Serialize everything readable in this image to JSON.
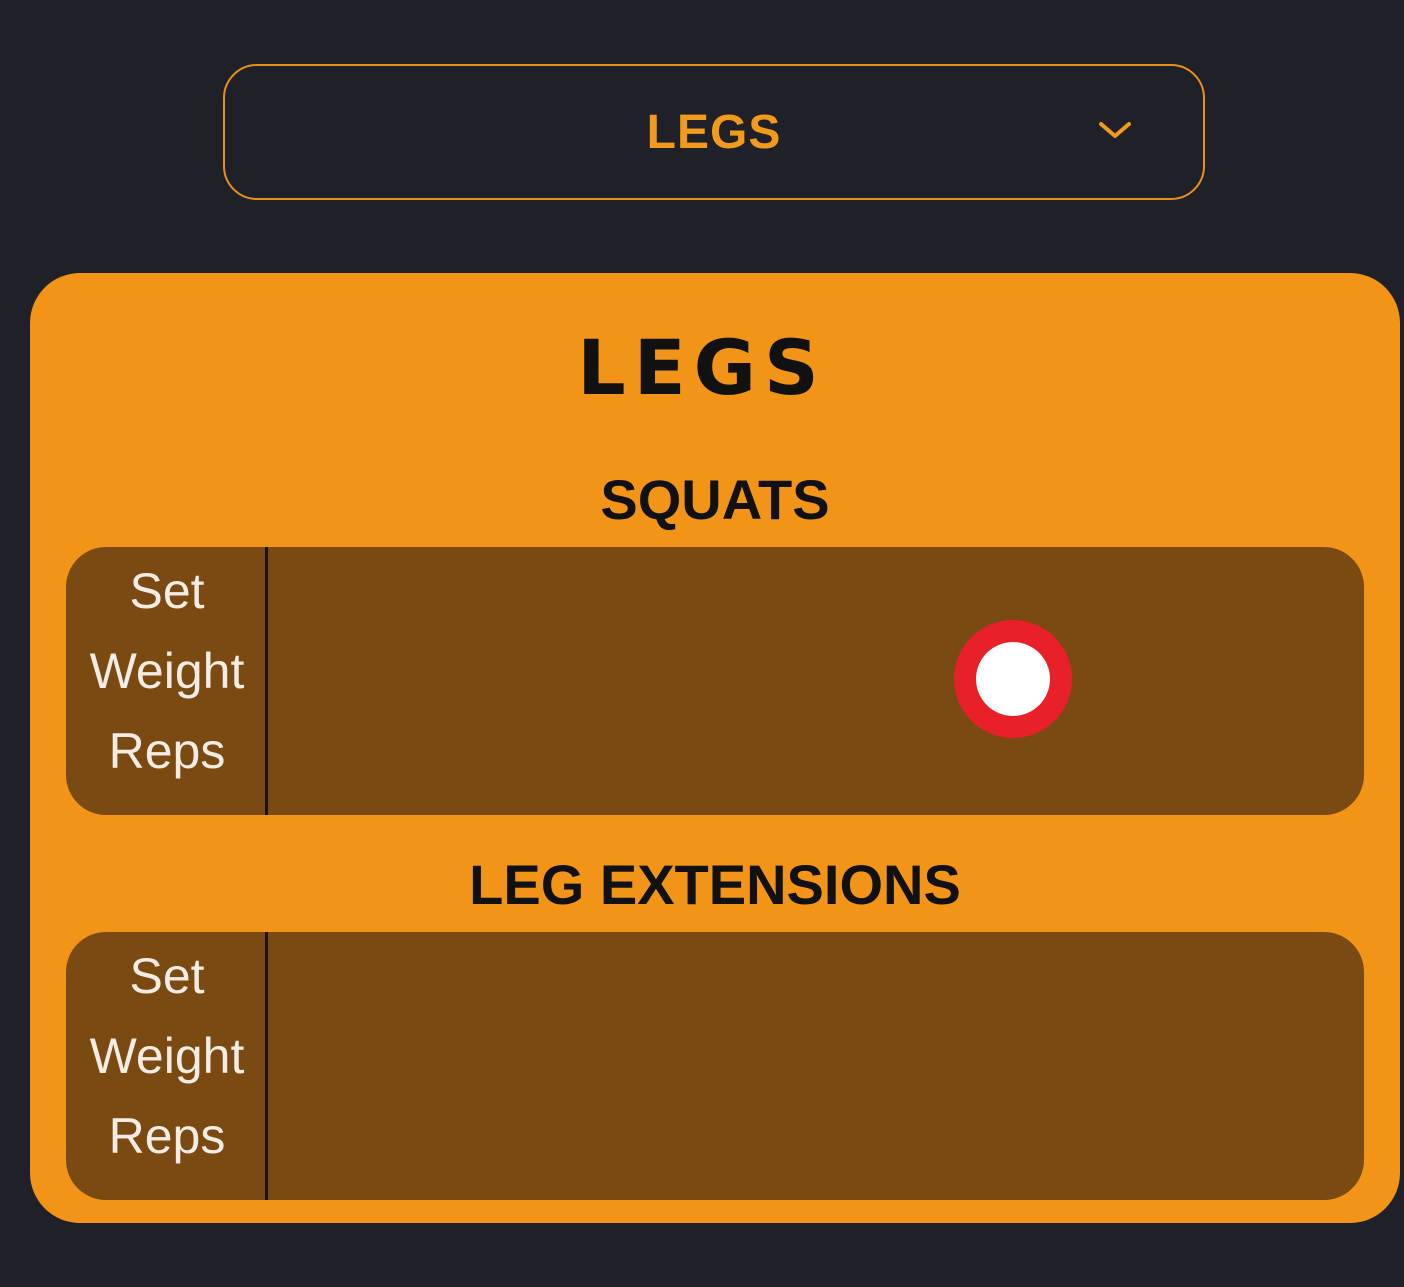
{
  "workout_selector": {
    "selected": "LEGS",
    "icon": "chevron-down-icon"
  },
  "workout_card": {
    "title": "LEGS",
    "exercises": [
      {
        "name": "SQUATS",
        "row_labels": [
          "Set",
          "Weight",
          "Reps"
        ]
      },
      {
        "name": "LEG EXTENSIONS",
        "row_labels": [
          "Set",
          "Weight",
          "Reps"
        ]
      }
    ]
  },
  "colors": {
    "background": "#1f2028",
    "accent": "#f29418",
    "panel": "#7a4a12",
    "touch_indicator": "#e8202a"
  }
}
